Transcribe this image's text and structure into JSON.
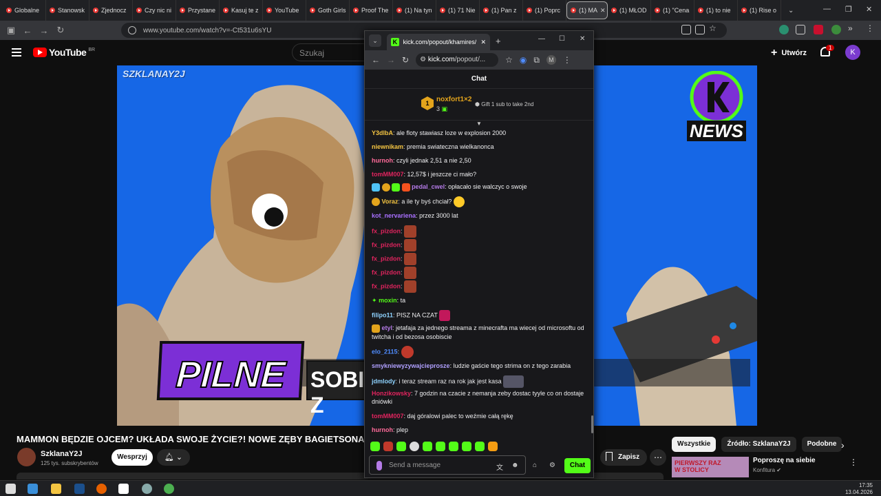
{
  "browser": {
    "tabs": [
      {
        "label": "Globalne"
      },
      {
        "label": "Stanowsk"
      },
      {
        "label": "Zjednocz"
      },
      {
        "label": "Czy nic ni"
      },
      {
        "label": "Przystane"
      },
      {
        "label": "Kasuj te z"
      },
      {
        "label": "YouTube"
      },
      {
        "label": "Goth Girls"
      },
      {
        "label": "Proof The"
      },
      {
        "label": "(1) Na tyn"
      },
      {
        "label": "(1) 71 Nie"
      },
      {
        "label": "(1) Pan z"
      },
      {
        "label": "(1) Poprc"
      },
      {
        "label": "(1) MA",
        "active": true
      },
      {
        "label": "(1) MŁOD"
      },
      {
        "label": "(1) \"Cena"
      },
      {
        "label": "(1) to nie"
      },
      {
        "label": "(1) Rise o"
      }
    ],
    "url": "www.youtube.com/watch?v=-Ct531u6sYU"
  },
  "youtube": {
    "logo": "YouTube",
    "region": "BR",
    "search_placeholder": "Szukaj",
    "create_label": "Utwórz",
    "notif_count": "1",
    "avatar_letter": "K",
    "video": {
      "watermark": "SZKLANAY2J",
      "badge_text": "PILNE",
      "overlay_text": "SOBIE Z",
      "logo_text": "NEWS"
    },
    "title": "MAMMON BĘDZIE OJCEM? UKŁADA SWOJE ŻYCIE?! NOWE ZĘBY BAGIETSONA! DRA",
    "channel": "SzklanaY2J",
    "subs": "125 tys. subskrybentów",
    "support_label": "Wesprzyj",
    "save_label": "Zapisz",
    "chips": [
      "Wszystkie",
      "Źródło: SzklanaY2J",
      "Podobne"
    ],
    "suggestion": {
      "title": "Poproszę na siebie",
      "channel": "Konfitura",
      "thumb_text": "PIERWSZY RAZ W STOLICY"
    }
  },
  "popup": {
    "tab_title": "kick.com/popout/khamires/cha",
    "url_host": "kick.com",
    "url_path": "/popout/...",
    "chat_title": "Chat",
    "pinned": {
      "rank": "1",
      "name": "noxfort1×2",
      "count": "3",
      "gift": "Gift 1 sub to take 2nd"
    },
    "messages": [
      {
        "user": "Y3dlbA",
        "color": "#f5c542",
        "text": "ale floty stawiasz loze w explosion 2000"
      },
      {
        "user": "niewnikam",
        "color": "#f5c542",
        "text": "premia swiateczna wielkanonca"
      },
      {
        "user": "hurnoh",
        "color": "#ff6b9a",
        "text": "czyli jednak 2,51 a nie 2,50"
      },
      {
        "user": "tomMM007",
        "color": "#e0245e",
        "text": "12,57$ i jeszcze ci mało?"
      },
      {
        "user": "pedal_cwel",
        "color": "#b57be8",
        "text": "opłacało sie walczyc o swoje"
      },
      {
        "user": "Voraz",
        "color": "#f5c542",
        "text": "a ile ty byś chciał?"
      },
      {
        "user": "kot_nervariena",
        "color": "#a970ff",
        "text": "przez 3000 lat"
      },
      {
        "user": "fx_pizdon",
        "color": "#e0245e",
        "text": ""
      },
      {
        "user": "fx_pizdon",
        "color": "#e0245e",
        "text": ""
      },
      {
        "user": "fx_pizdon",
        "color": "#e0245e",
        "text": ""
      },
      {
        "user": "fx_pizdon",
        "color": "#e0245e",
        "text": ""
      },
      {
        "user": "fx_pizdon",
        "color": "#e0245e",
        "text": ""
      },
      {
        "user": "moxin",
        "color": "#53fc18",
        "text": "ta"
      },
      {
        "user": "filipo11",
        "color": "#8fd3ff",
        "text": "PISZ NA CZAT"
      },
      {
        "user": "etyl",
        "color": "#b57be8",
        "text": "jetafaja za jednego streama z minecrafta ma wiecej od microsoftu od twitcha i od bezosa osobiscie"
      },
      {
        "user": "elo_2115",
        "color": "#4f8cff",
        "text": ""
      },
      {
        "user": "smykniewyzywajcieprosze",
        "color": "#b0a0ff",
        "text": "ludzie gaście tego strima on z tego zarabia"
      },
      {
        "user": "jdmlody",
        "color": "#8fd3ff",
        "text": "i teraz stream raz na rok jak jest kasa"
      },
      {
        "user": "Honzikowsky",
        "color": "#e0245e",
        "text": "7 godzin na czacie z nemanja zeby dostac tyyle co on dostaje dniówki"
      },
      {
        "user": "tomMM007",
        "color": "#e0245e",
        "text": "daj góralowi palec to weźmie całą rękę"
      },
      {
        "user": "hurnoh",
        "color": "#ff6b9a",
        "text": "plep"
      }
    ],
    "composer_placeholder": "Send a message",
    "chat_button": "Chat"
  },
  "taskbar": {
    "time": "17:35",
    "date": "13.04.2026"
  }
}
